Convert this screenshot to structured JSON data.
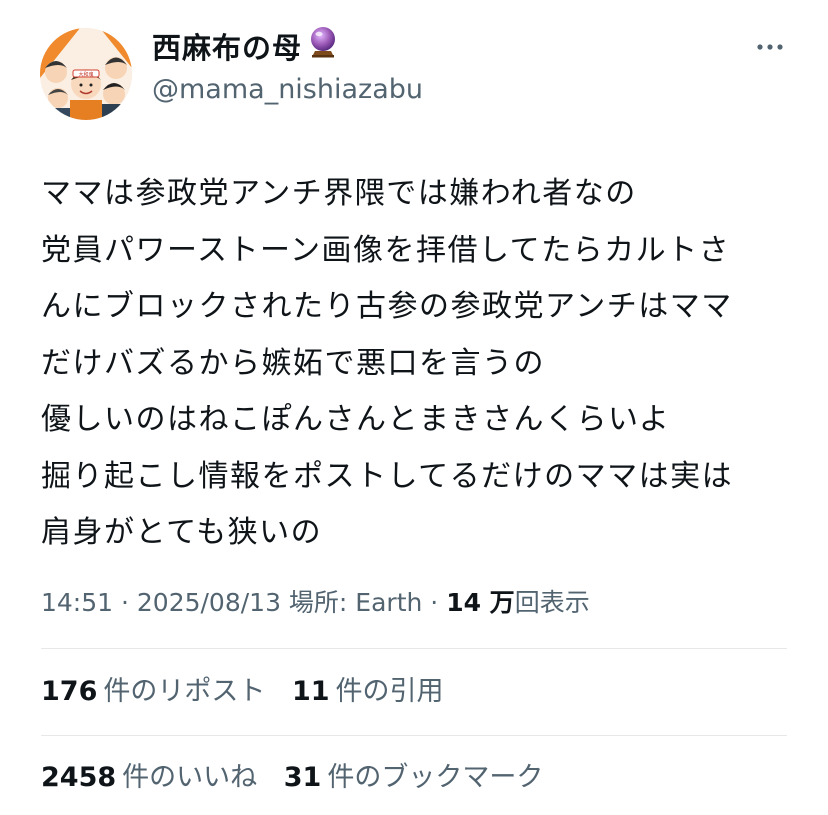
{
  "author": {
    "display_name": "西麻布の母",
    "name_emoji": "crystal-ball-icon",
    "handle": "@mama_nishiazabu",
    "avatar_banner_text": "大和魂"
  },
  "tweet": {
    "lines": [
      "ママは参政党アンチ界隈では嫌われ者なの",
      "党員パワーストーン画像を拝借してたらカルトさ",
      "んにブロックされたり古参の参政党アンチはママ",
      "だけバズるから嫉妬で悪口を言うの",
      "優しいのはねこぽんさんとまきさんくらいよ",
      "掘り起こし情報をポストしてるだけのママは実は",
      "肩身がとても狭いの"
    ]
  },
  "meta": {
    "prefix": "14:51 · 2025/08/13 場所: Earth · ",
    "views_number": "14 万",
    "views_label": "回表示"
  },
  "stats": {
    "reposts": {
      "count": "176",
      "label": "件のリポスト"
    },
    "quotes": {
      "count": "11",
      "label": "件の引用"
    },
    "likes": {
      "count": "2458",
      "label": "件のいいね"
    },
    "bookmarks": {
      "count": "31",
      "label": "件のブックマーク"
    }
  },
  "colors": {
    "text": "#0f1419",
    "secondary": "#536471",
    "divider": "#e6e8ea",
    "crystal_ball": "#8e44ad"
  }
}
